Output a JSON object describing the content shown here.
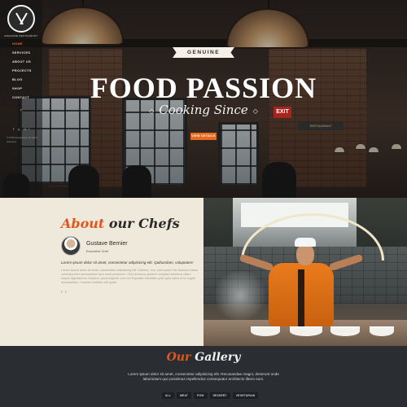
{
  "brand": {
    "logo_text": "ESQUARE RESTAURANT"
  },
  "sidebar": {
    "items": [
      {
        "label": "HOME"
      },
      {
        "label": "SERVICES"
      },
      {
        "label": "ABOUT US"
      },
      {
        "label": "PROJECTS"
      },
      {
        "label": "BLOG"
      },
      {
        "label": "SHOP"
      },
      {
        "label": "CONTACT"
      }
    ],
    "social": "f y G+",
    "footer": "© 2016 Restaurant, all rights reserved"
  },
  "hero": {
    "ribbon": "GENUINE",
    "title": "FOOD PASSION",
    "subtitle": "Cooking Since",
    "button": "VIEW DETAILS",
    "exit_sign": "EXIT",
    "board": "RESTAURANT"
  },
  "about": {
    "title_part1": "About",
    "title_part2": "our Chefs",
    "chef_name": "Gustave Bernier",
    "chef_role": "Executive Chef",
    "lead": "Lorem ipsum dolor sit amet, consectetur adipisicing elit. Quibusdam, voluptates!",
    "body": "Lorem ipsum dolor sit amet, consectetur adipisicing elit. Dolores, non, eum ipsum hic dolorum totam consequuntur accusantium quo modi possimus. Vero ducimus quidem voluptas doloribus ullam eaque dignissimos. Adipisci, quod eligendi cum ea! Expedita blanditiis optio quia natus error fugiat accusantium. Incidunt veritatis odit quasi.",
    "arrows": "‹ ›"
  },
  "gallery": {
    "title_part1": "Our",
    "title_part2": "Gallery",
    "text": "Lorem ipsum dolor sit amet, consectetur adipisicing elit. Recusandae magni, deserunt unde laboriosam quo possimus repellendus consequatur architecto libero eum.",
    "filters": [
      "ALL",
      "MEAT",
      "FISH",
      "DESSERT",
      "VEGETARIAN"
    ]
  },
  "colors": {
    "accent": "#e86a1e",
    "cream": "#efe9dc",
    "dark": "#2a2e33"
  }
}
